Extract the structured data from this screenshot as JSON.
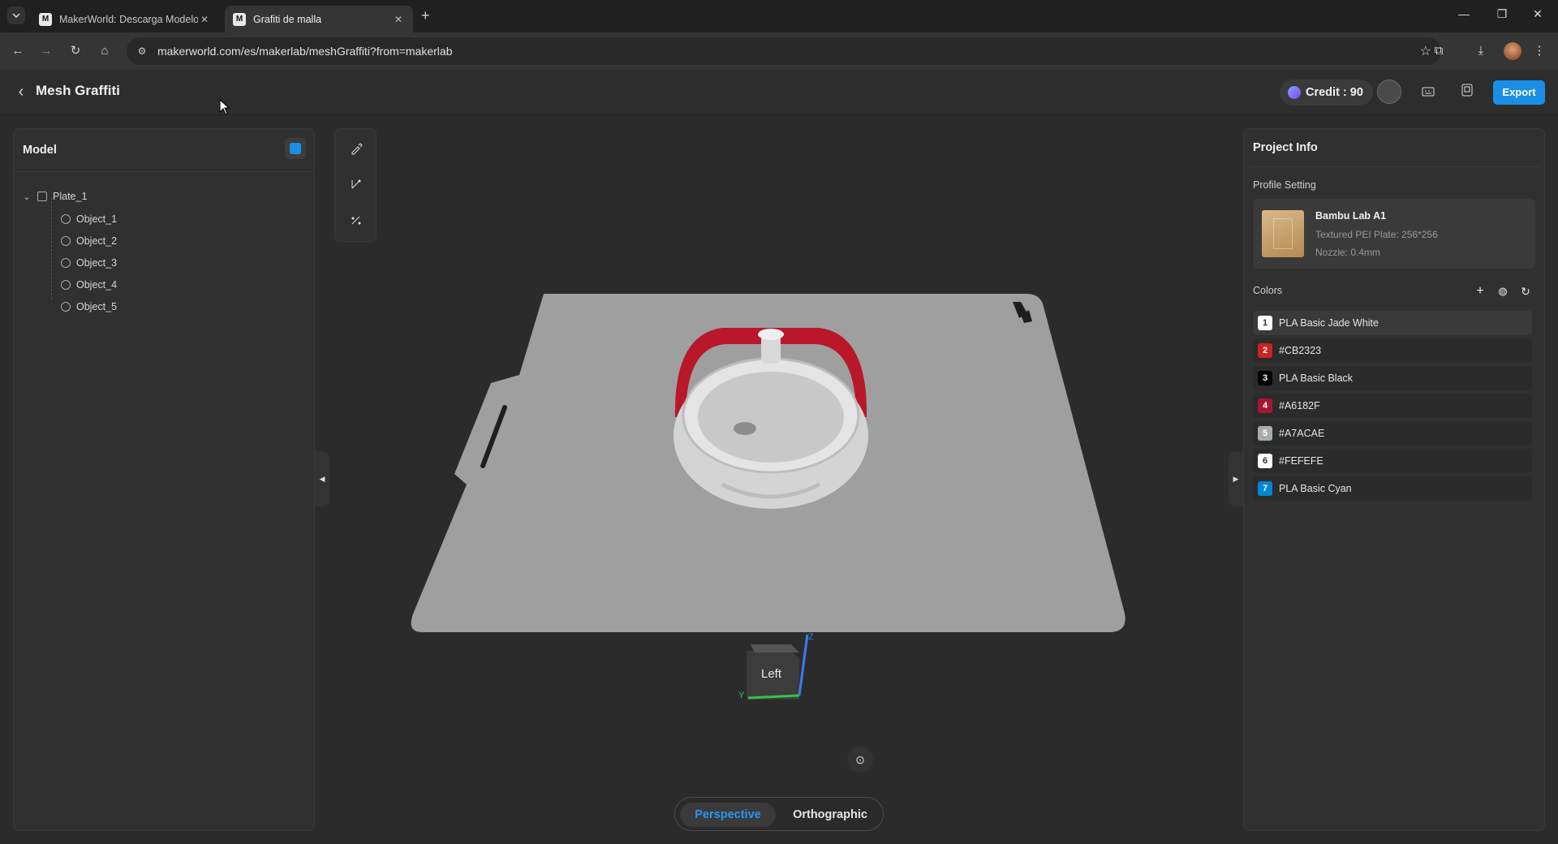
{
  "browser": {
    "tabs": [
      {
        "label": "MakerWorld: Descarga Modelo",
        "active": false
      },
      {
        "label": "Grafiti de malla",
        "active": true
      }
    ],
    "url": "makerworld.com/es/makerlab/meshGraffiti?from=makerlab"
  },
  "app": {
    "title": "Mesh Graffiti",
    "credit_label": "Credit : 90",
    "export_label": "Export"
  },
  "left_panel": {
    "title": "Model",
    "plate": "Plate_1",
    "objects": [
      "Object_1",
      "Object_2",
      "Object_3",
      "Object_4",
      "Object_5"
    ]
  },
  "viewport": {
    "orientation_label": "Left",
    "axis_z": "Z",
    "axis_y": "Y",
    "view_modes": {
      "active": "Perspective",
      "inactive": "Orthographic"
    },
    "plate_color": "#a0a0a0",
    "handle_color": "#b8182a",
    "body_color": "#d6d6d6"
  },
  "right_panel": {
    "title": "Project Info",
    "profile_setting_label": "Profile Setting",
    "profile": {
      "printer": "Bambu Lab A1",
      "plate": "Textured PEI Plate: 256*256",
      "nozzle": "Nozzle: 0.4mm"
    },
    "colors_label": "Colors",
    "colors": [
      {
        "num": "1",
        "name": "PLA Basic Jade White",
        "hex": "#FFFFFF",
        "text": "#333333"
      },
      {
        "num": "2",
        "name": "#CB2323",
        "hex": "#CB2323",
        "text": "#FFFFFF"
      },
      {
        "num": "3",
        "name": "PLA Basic Black",
        "hex": "#000000",
        "text": "#FFFFFF"
      },
      {
        "num": "4",
        "name": "#A6182F",
        "hex": "#A6182F",
        "text": "#FFFFFF"
      },
      {
        "num": "5",
        "name": "#A7ACAE",
        "hex": "#A7ACAE",
        "text": "#FFFFFF"
      },
      {
        "num": "6",
        "name": "#FEFEFE",
        "hex": "#FEFEFE",
        "text": "#333333"
      },
      {
        "num": "7",
        "name": "PLA Basic Cyan",
        "hex": "#0086D6",
        "text": "#FFFFFF"
      }
    ]
  },
  "colors": {
    "accent": "#1b8fe6",
    "background": "#2b2b2b"
  }
}
